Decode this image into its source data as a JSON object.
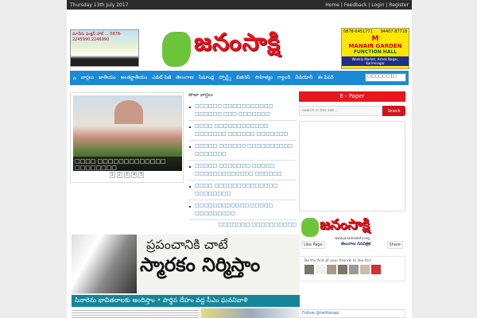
{
  "topbar": {
    "date": "Thursday 13th July 2017",
    "links": [
      "Home",
      "Feedback",
      "Login",
      "Register"
    ]
  },
  "header": {
    "logo_text": "జనంసాక్షి",
    "ad_left": {
      "text": "మానేరు ఫంక్షన్ హాల్ ... 0878-2245990,2246990"
    },
    "ad_right": {
      "phone1": "0878-6451771",
      "phone2": "94407 87718",
      "name": "MANAIR GARDEN",
      "subtitle": "FUNCTION HALL",
      "address": "Weekly Market, Ashok Nagar, Karimnagar"
    }
  },
  "nav": {
    "home_icon": "home-icon",
    "items": [
      "వార్తలు",
      "జాతీయం",
      "అంతర్జాతీయం",
      "ఎడిట్ పేజీ",
      "తెలంగాణ",
      "సీమాంధ్ర",
      "స్పోర్ట్స్",
      "బిజినెస్",
      "సాహిత్యం",
      "గ్యాలరీ",
      "వీడియోస్",
      "ఈ పేపర్"
    ],
    "select_value": "□□□□□□ [□"
  },
  "slider": {
    "caption": "□□□□ □□□□□□□□□□□□□ □□□□□□□□",
    "pages": [
      "1",
      "2",
      "3",
      "4",
      "5"
    ]
  },
  "latest": {
    "title": "తాజా వార్తలు",
    "items": [
      "□□□□□□ □□□□□□□□□□□ □□□□□□ □□□ □□□□□□□",
      "□□□□ □□□□□□□□□□□□ □□□□□□□ □□□□□□ □□□□□□□",
      "□□□□□ □□□□□□ □□□□□□□□□□ □□□□□□□",
      "□□□□□ □□□□□□□ □□□□□ □□□□□□□□□□□□□ □□□□□□",
      "□□□□ □□□□□□□□□□□□□□ □□□□□□□□",
      "□□□□□□□□□□□□ □□□□□ □□□□□□□□□"
    ],
    "more": "□□□□□□□ □□□□□□□□□□"
  },
  "sidebar": {
    "epaper": "E - Paper",
    "search_placeholder": "Search in this site...",
    "search_button": "Search",
    "fb_logo": "జనంసాక్షి",
    "fb_url": "www.janamsakshi.org",
    "like_page": "Like Page",
    "tn": "తెలంగాణ దినపత్రిక",
    "share": "Share",
    "friends_text": "Be the first of your friends to like this",
    "follow": "Follow @twitterapi"
  },
  "banner": {
    "headline1": "ప్రపంచానికి చాటే",
    "headline2": "స్మారకం నిర్మిస్తాం",
    "strip": "సినారెను భావితరాలకు అందిస్తాం  • పార్థివ దేహం వద్ద సీఎం ఘననివాళి"
  }
}
